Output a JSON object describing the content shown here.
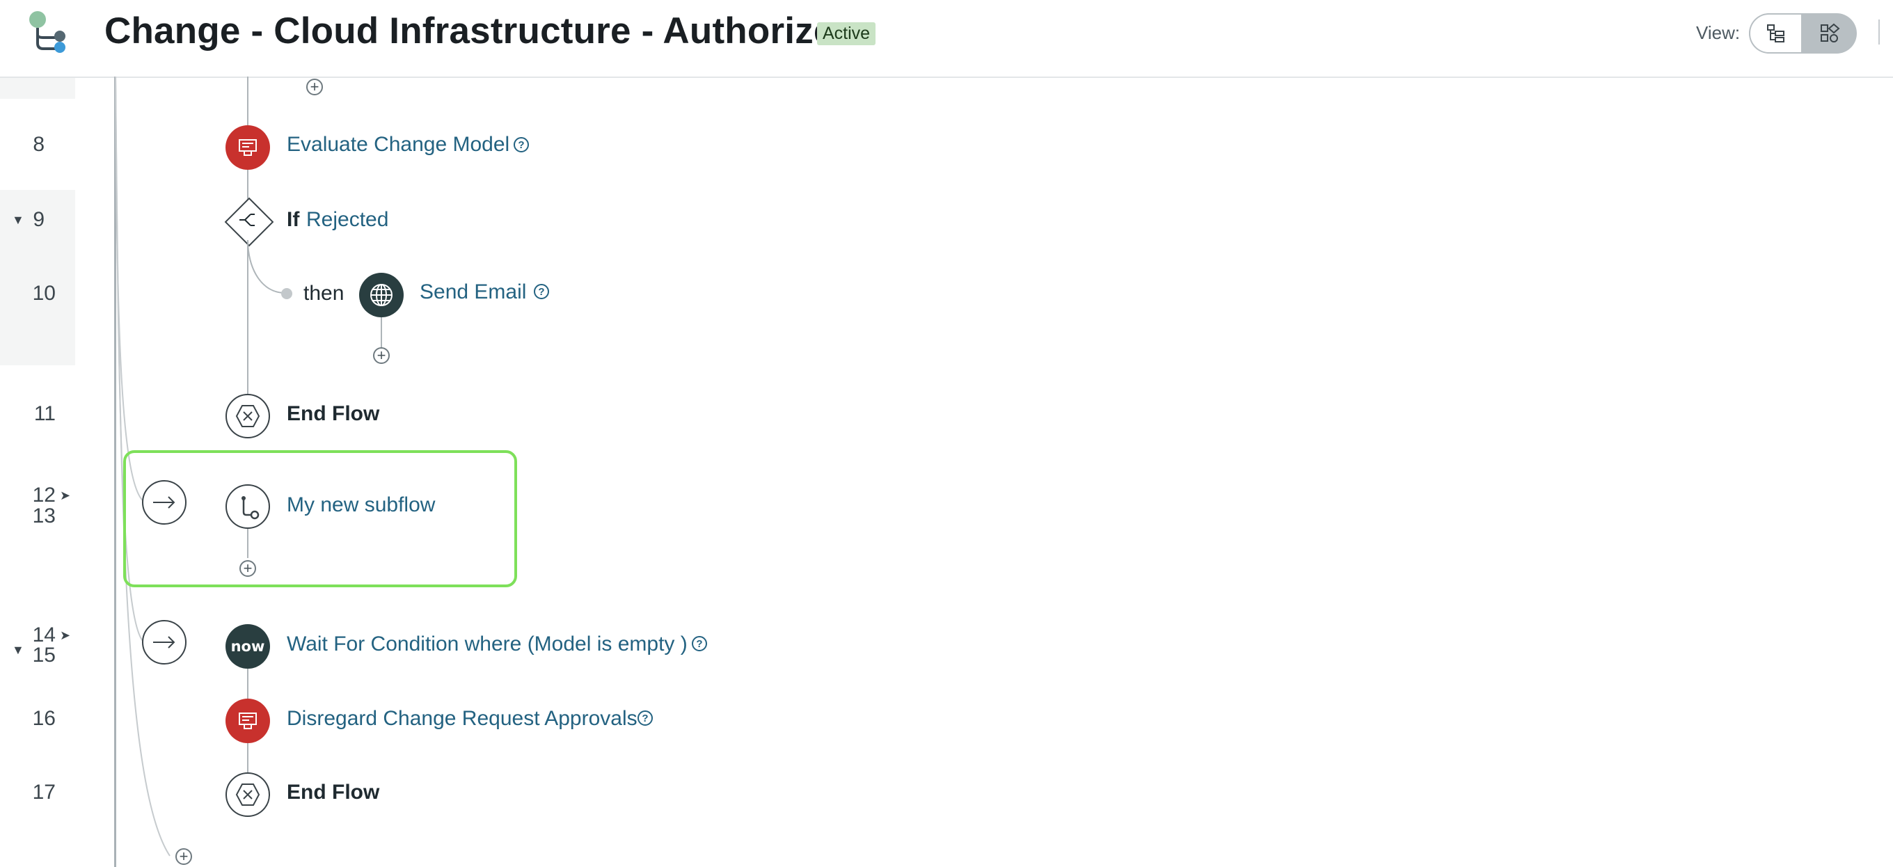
{
  "header": {
    "title": "Change - Cloud Infrastructure - Authorize",
    "status_badge": "Active",
    "view_label": "View:"
  },
  "steps": {
    "step8": {
      "line": "8",
      "label": "Evaluate Change Model",
      "icon": "action-icon"
    },
    "step9": {
      "line": "9",
      "keyword": "If",
      "condition": "Rejected",
      "icon": "condition-icon"
    },
    "step10": {
      "line": "10",
      "keyword": "then",
      "label": "Send Email",
      "icon": "globe-icon"
    },
    "step11": {
      "line": "11",
      "label": "End Flow",
      "icon": "end-flow-icon"
    },
    "step12": {
      "line": "12",
      "line2": "13",
      "label": "My new subflow",
      "icon": "subflow-icon"
    },
    "step14": {
      "line": "14",
      "line2": "15",
      "label": "Wait For Condition where (Model is empty )",
      "icon": "now-icon",
      "icon_text": "now"
    },
    "step16": {
      "line": "16",
      "label": "Disregard Change Request Approvals",
      "icon": "action-icon"
    },
    "step17": {
      "line": "17",
      "label": "End Flow",
      "icon": "end-flow-icon"
    }
  },
  "colors": {
    "link": "#236281",
    "action_red": "#c8312d",
    "now_dark": "#293e40",
    "highlight": "#7ee05a",
    "badge_bg": "#c9e3c5"
  }
}
